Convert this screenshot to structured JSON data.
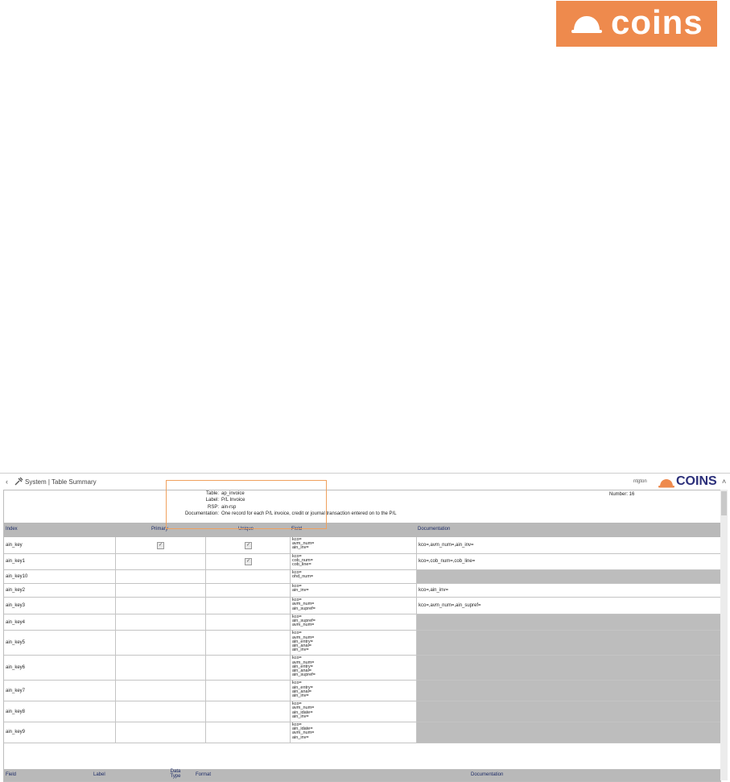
{
  "brand": {
    "name": "coins",
    "color": "#ee8a4d"
  },
  "app": {
    "title": "System | Table Summary",
    "user": "ntgton",
    "logo": "COINS",
    "info": {
      "table_label": "Table:",
      "table": "ap_invoice",
      "label_label": "Label:",
      "label": "P/L Invoice",
      "rsp_label": "RSP:",
      "rsp": "ain-rsp",
      "doc_label": "Documentation:",
      "doc": "One record for each P/L invoice, credit or journal transaction entered on to the P/L",
      "number": "Number: 16"
    },
    "index_headers": [
      "Index",
      "Primary",
      "Unique",
      "Field",
      "Documentation"
    ],
    "indexes": [
      {
        "name": "ain_key",
        "primary": true,
        "unique": true,
        "fields": [
          "kco=",
          "avm_num=",
          "ain_inv="
        ],
        "doc": "kco=,avm_num=,ain_inv="
      },
      {
        "name": "ain_key1",
        "primary": false,
        "unique": true,
        "fields": [
          "kco=",
          "cob_num=",
          "cob_line="
        ],
        "doc": "kco=,cob_num=,cob_line="
      },
      {
        "name": "ain_key10",
        "primary": false,
        "unique": false,
        "fields": [
          "kco=",
          "ohd_num="
        ],
        "doc": ""
      },
      {
        "name": "ain_key2",
        "primary": false,
        "unique": false,
        "fields": [
          "kco=",
          "ain_inv="
        ],
        "doc": "kco=,ain_inv="
      },
      {
        "name": "ain_key3",
        "primary": false,
        "unique": false,
        "fields": [
          "kco=",
          "avm_num=",
          "ain_supref="
        ],
        "doc": "kco=,avm_num=,ain_supref="
      },
      {
        "name": "ain_key4",
        "primary": false,
        "unique": false,
        "fields": [
          "kco=",
          "ain_supref=",
          "avm_num="
        ],
        "doc": ""
      },
      {
        "name": "ain_key5",
        "primary": false,
        "unique": false,
        "fields": [
          "kco=",
          "avm_num=",
          "ain_entry=",
          "ain_anal=",
          "ain_inv="
        ],
        "doc": ""
      },
      {
        "name": "ain_key6",
        "primary": false,
        "unique": false,
        "fields": [
          "kco=",
          "avm_num=",
          "ain_entry=",
          "ain_anal=",
          "ain_supref="
        ],
        "doc": ""
      },
      {
        "name": "ain_key7",
        "primary": false,
        "unique": false,
        "fields": [
          "kco=",
          "ain_entry=",
          "ain_anal=",
          "ain_inv="
        ],
        "doc": ""
      },
      {
        "name": "ain_key8",
        "primary": false,
        "unique": false,
        "fields": [
          "kco=",
          "avm_num=",
          "ain_idate=",
          "ain_inv="
        ],
        "doc": ""
      },
      {
        "name": "ain_key9",
        "primary": false,
        "unique": false,
        "fields": [
          "kco=",
          "ain_idate=",
          "avm_num=",
          "ain_inv="
        ],
        "doc": ""
      }
    ],
    "field_headers": {
      "field": "Field",
      "label": "Label",
      "datatype": "Data Type",
      "format": "Format",
      "doc": "Documentation"
    }
  }
}
